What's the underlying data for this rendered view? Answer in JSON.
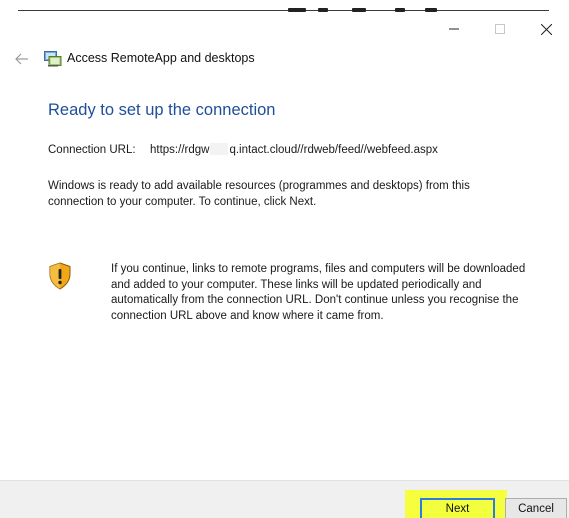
{
  "window": {
    "controls": {
      "minimize_icon": "minimize-icon",
      "maximize_icon": "maximize-icon",
      "close_icon": "close-icon"
    }
  },
  "header": {
    "back_icon": "back-arrow-icon",
    "app_icon": "remoteapp-icon",
    "title": "Access RemoteApp and desktops"
  },
  "main": {
    "heading": "Ready to set up the connection",
    "connection_url_label": "Connection URL:",
    "connection_url_part1": "https://rdgw",
    "connection_url_part2": "q.intact.cloud//rdweb/feed//webfeed.aspx",
    "intro": "Windows is ready to add available resources (programmes and desktops) from this connection to your computer. To continue, click Next.",
    "warning_icon": "shield-warning-icon",
    "warning_text": "If you continue, links to remote programs, files and computers will be downloaded and added to your computer. These links will be updated periodically and automatically from the connection URL. Don't continue unless you recognise the connection URL above and know where it came from."
  },
  "footer": {
    "next_label": "Next",
    "cancel_label": "Cancel",
    "highlight_color": "#f5ff40"
  },
  "colors": {
    "heading": "#1f4e9a",
    "footer_bg": "#f0f0f0",
    "focus_border": "#2b7de1"
  }
}
